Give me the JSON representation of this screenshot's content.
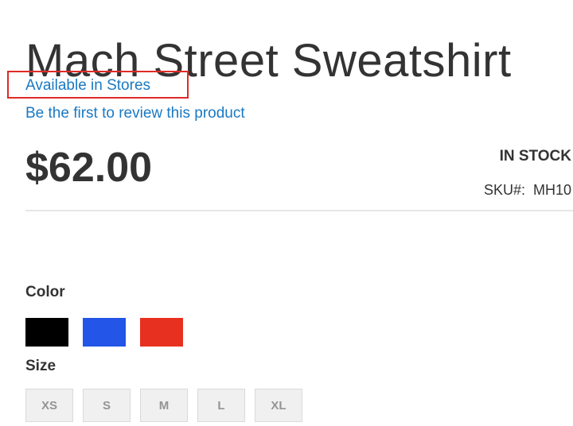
{
  "product": {
    "title": "Mach Street Sweatshirt",
    "availability_link": "Available in Stores",
    "review_link": "Be the first to review this product",
    "price": "$62.00",
    "stock_status": "IN STOCK",
    "sku_label": "SKU#:",
    "sku_value": "MH10"
  },
  "options": {
    "color_label": "Color",
    "colors": [
      {
        "name": "Black",
        "hex": "#000000"
      },
      {
        "name": "Blue",
        "hex": "#2355e8"
      },
      {
        "name": "Red",
        "hex": "#e83020"
      }
    ],
    "size_label": "Size",
    "sizes": [
      "XS",
      "S",
      "M",
      "L",
      "XL"
    ]
  },
  "theme": {
    "link_color": "#1979c3",
    "highlight_border": "#e02b27"
  }
}
